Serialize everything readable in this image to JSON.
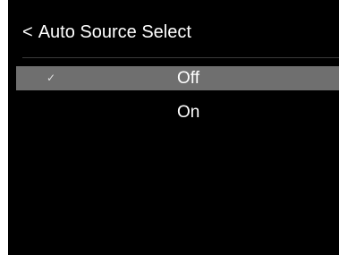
{
  "header": {
    "back_glyph": "<",
    "title": "Auto Source Select"
  },
  "options": [
    {
      "label": "Off",
      "selected": true,
      "check_glyph": "✓",
      "icon": "check-icon"
    },
    {
      "label": "On",
      "selected": false
    }
  ],
  "colors": {
    "background": "#000000",
    "text": "#ffffff",
    "highlight": "#6f6f6f"
  }
}
